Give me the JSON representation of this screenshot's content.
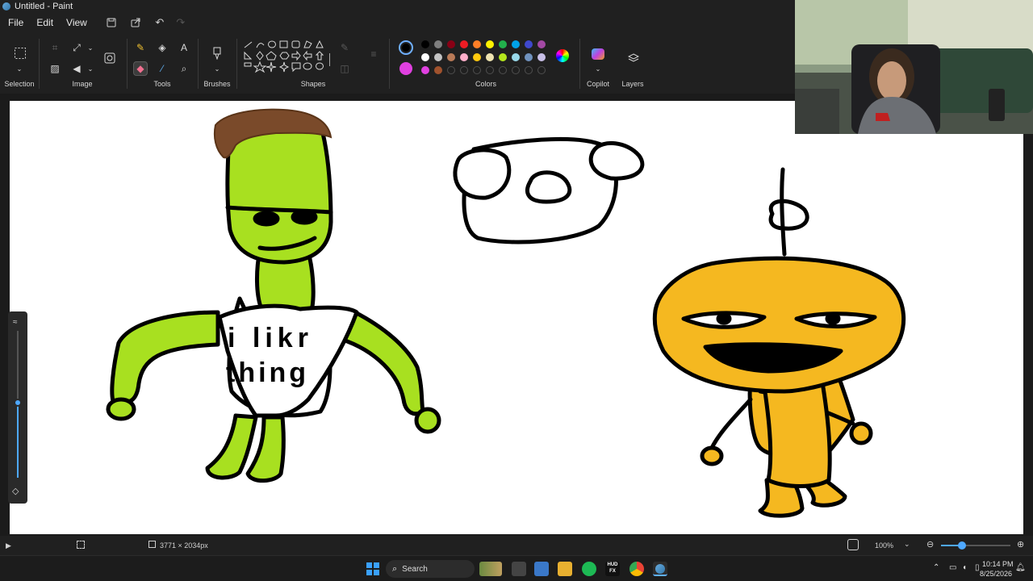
{
  "window": {
    "title": "Untitled - Paint"
  },
  "menu": {
    "file": "File",
    "edit": "Edit",
    "view": "View"
  },
  "ribbon": {
    "groups": {
      "selection": "Selection",
      "image": "Image",
      "tools": "Tools",
      "brushes": "Brushes",
      "shapes": "Shapes",
      "colors": "Colors",
      "copilot": "Copilot",
      "layers": "Layers"
    },
    "active_tool": "eraser",
    "primary_color": "#000000",
    "secondary_color": "#ffffff",
    "palette_row1": [
      "#000000",
      "#7f7f7f",
      "#880015",
      "#ed1c24",
      "#ff7f27",
      "#fff200",
      "#22b14c",
      "#00a2e8",
      "#3f48cc",
      "#a349a4"
    ],
    "palette_row2": [
      "#ffffff",
      "#c3c3c3",
      "#b97a57",
      "#ffaec9",
      "#ffc90e",
      "#efe4b0",
      "#b5e61d",
      "#99d9ea",
      "#7092be",
      "#c8bfe7"
    ],
    "palette_row3": [
      "#e040e0",
      "#a0522d"
    ]
  },
  "canvas": {
    "shirt_text_line1": "i likr",
    "shirt_text_line2": "thing",
    "colors": {
      "green": "#a8e020",
      "hair": "#7a4a2a",
      "yellow": "#f5b820"
    }
  },
  "statusbar": {
    "canvas_size": "3771 × 2034px",
    "zoom": "100%",
    "zoom_level": 0.3
  },
  "taskbar": {
    "search_placeholder": "Search",
    "time": "10:14 PM",
    "date": "8/25/2026",
    "hud_label": "HUD\nFX"
  }
}
